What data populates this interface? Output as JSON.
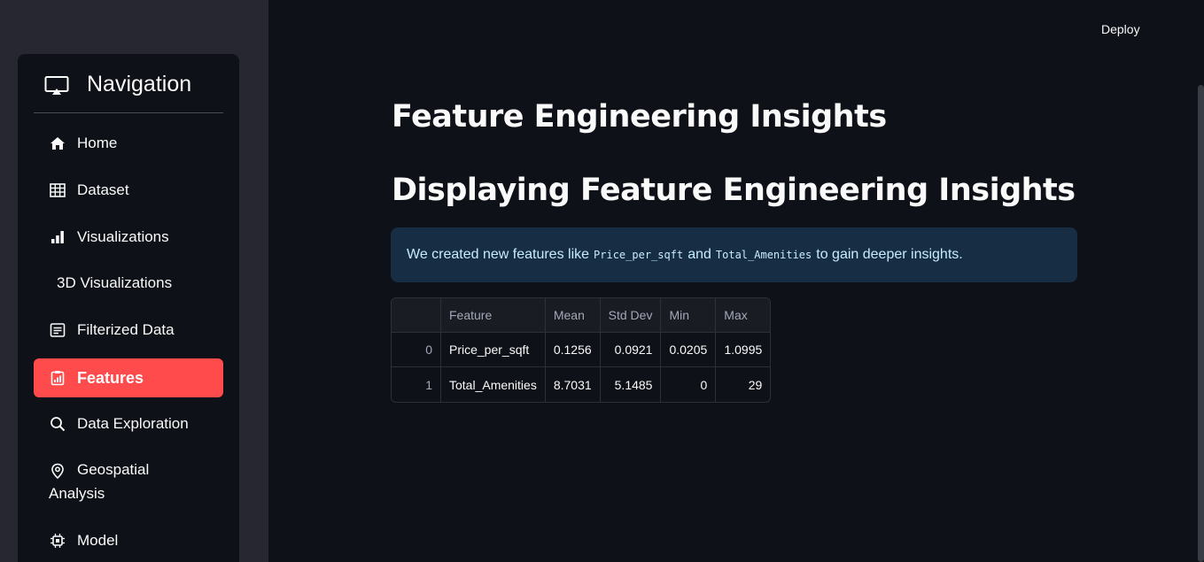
{
  "header": {
    "deploy_label": "Deploy"
  },
  "sidebar": {
    "title": "Navigation",
    "items": [
      {
        "label": "Home",
        "icon": "home-icon"
      },
      {
        "label": "Dataset",
        "icon": "table-icon"
      },
      {
        "label": "Visualizations",
        "icon": "bar-chart-icon"
      },
      {
        "label": "3D Visualizations",
        "icon": ""
      },
      {
        "label": "Filterized Data",
        "icon": "filter-list-icon"
      },
      {
        "label": "Features",
        "icon": "clipboard-chart-icon",
        "active": true
      },
      {
        "label": "Data Exploration",
        "icon": "search-icon"
      },
      {
        "label": "Geospatial Analysis",
        "icon": "location-pin-icon"
      },
      {
        "label": "Model",
        "icon": "chip-icon"
      }
    ],
    "accent_color": "#ff4b4b"
  },
  "main": {
    "title": "Feature Engineering Insights",
    "subtitle": "Displaying Feature Engineering Insights",
    "info": {
      "prefix": "We created new features like",
      "code1": "Price_per_sqft",
      "middle": "and",
      "code2": "Total_Amenities",
      "suffix": "to gain deeper insights."
    },
    "table": {
      "columns": [
        "",
        "Feature",
        "Mean",
        "Std Dev",
        "Min",
        "Max"
      ],
      "rows": [
        [
          "0",
          "Price_per_sqft",
          "0.1256",
          "0.0921",
          "0.0205",
          "1.0995"
        ],
        [
          "1",
          "Total_Amenities",
          "8.7031",
          "5.1485",
          "0",
          "29"
        ]
      ]
    }
  }
}
